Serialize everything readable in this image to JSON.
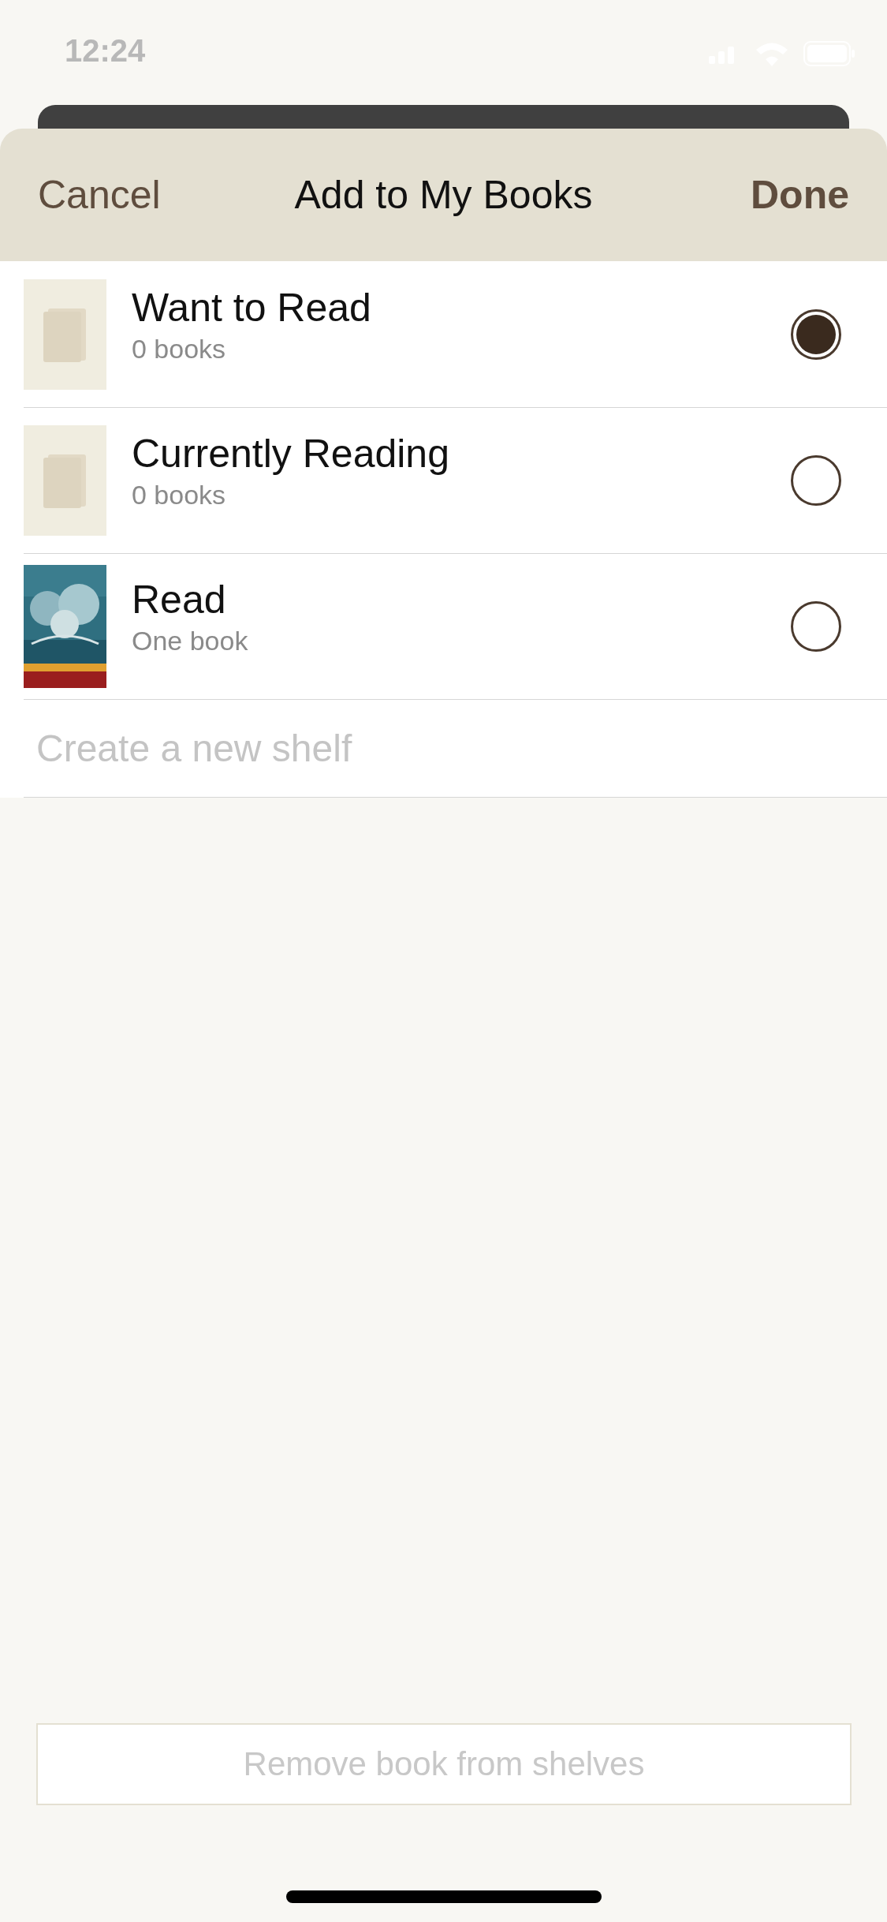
{
  "status_bar": {
    "time": "12:24"
  },
  "header": {
    "cancel": "Cancel",
    "title": "Add to My Books",
    "done": "Done"
  },
  "shelves": [
    {
      "name": "Want to Read",
      "count": "0 books",
      "kind": "placeholder",
      "selected": true
    },
    {
      "name": "Currently Reading",
      "count": "0 books",
      "kind": "placeholder",
      "selected": false
    },
    {
      "name": "Read",
      "count": "One book",
      "kind": "picture",
      "selected": false
    }
  ],
  "new_shelf": {
    "placeholder": "Create a new shelf"
  },
  "remove_button": {
    "label": "Remove book from shelves",
    "disabled": true
  }
}
